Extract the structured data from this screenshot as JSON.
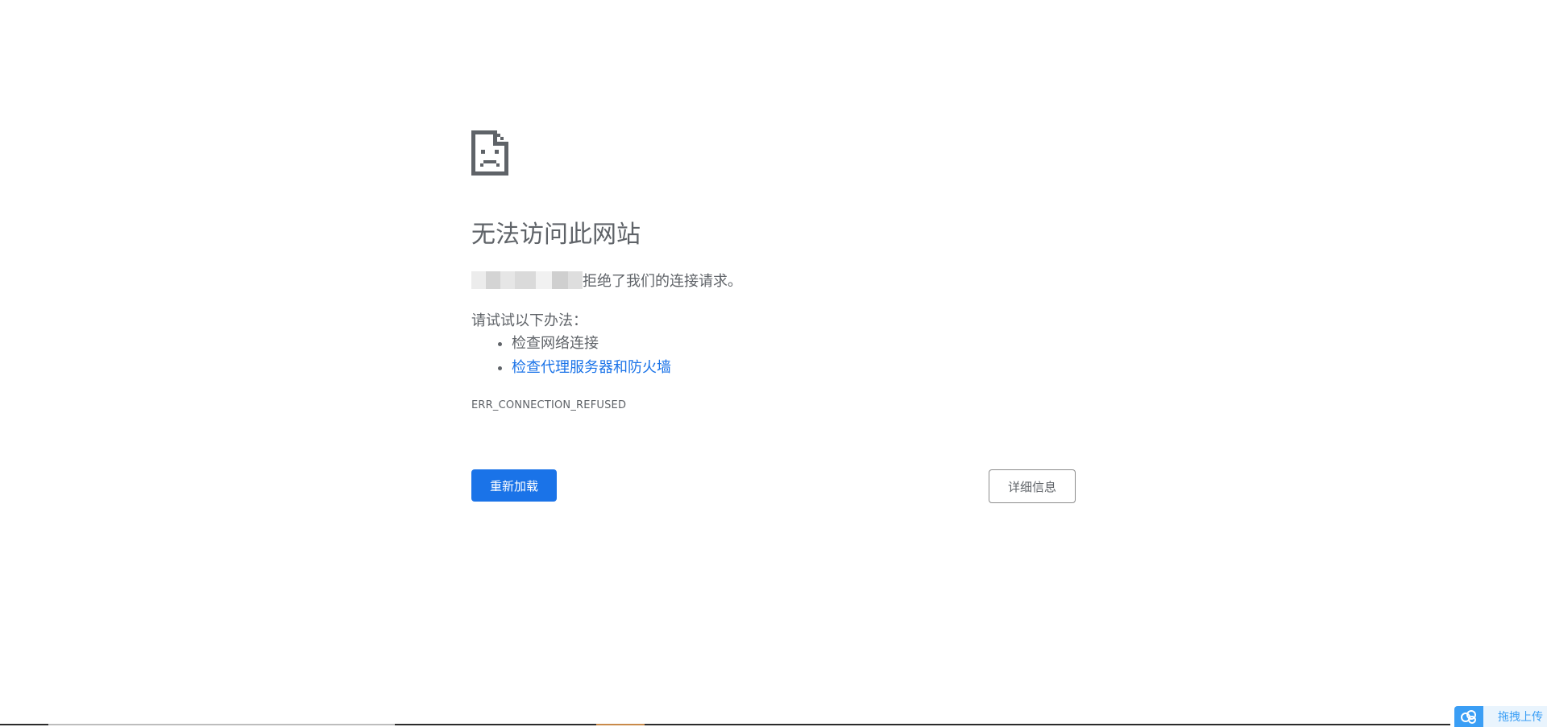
{
  "error_page": {
    "icon": "sad-document-icon",
    "title": "无法访问此网站",
    "host_redacted": true,
    "description": "拒绝了我们的连接请求。",
    "suggestions_label": "请试试以下办法：",
    "suggestions": [
      {
        "label": "检查网络连接",
        "is_link": false
      },
      {
        "label": "检查代理服务器和防火墙",
        "is_link": true
      }
    ],
    "error_code": "ERR_CONNECTION_REFUSED",
    "reload_button": "重新加载",
    "details_button": "详细信息"
  },
  "upload_widget": {
    "icon": "cloud-upload-icon",
    "label": "拖拽上传"
  },
  "colors": {
    "text": "#5f6368",
    "link": "#1a73e8",
    "primary_button": "#1a73e8",
    "upload_accent": "#3a9ef5"
  }
}
